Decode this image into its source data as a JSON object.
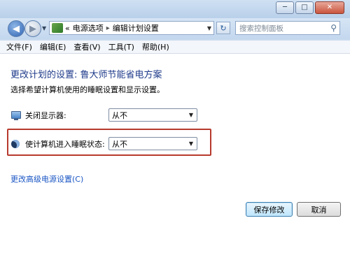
{
  "window": {
    "buttons": {
      "minimize": "─",
      "maximize": "□",
      "close": "✕"
    }
  },
  "address": {
    "overflow": "«",
    "crumbs": [
      "电源选项",
      "编辑计划设置"
    ],
    "separator": "▸",
    "refresh": "↻"
  },
  "search": {
    "placeholder": "搜索控制面板"
  },
  "menu": {
    "items": [
      "文件(F)",
      "编辑(E)",
      "查看(V)",
      "工具(T)",
      "帮助(H)"
    ]
  },
  "main": {
    "title": "更改计划的设置: 鲁大师节能省电方案",
    "subtitle": "选择希望计算机使用的睡眠设置和显示设置。",
    "display_off": {
      "label": "关闭显示器:",
      "value": "从不",
      "icon": "monitor-icon"
    },
    "sleep": {
      "label": "使计算机进入睡眠状态:",
      "value": "从不",
      "icon": "moon-icon"
    },
    "advanced_link": "更改高级电源设置(C)",
    "save_button": "保存修改",
    "cancel_button": "取消"
  },
  "colors": {
    "title": "#1e3a8a",
    "link": "#1a56c4",
    "highlight_box": "#b73a2e"
  }
}
